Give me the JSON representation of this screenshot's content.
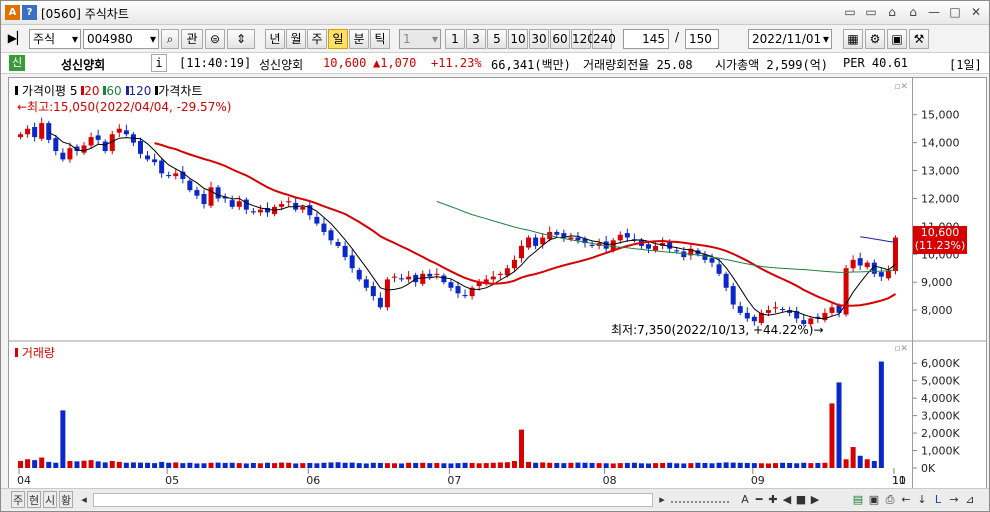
{
  "titlebar": {
    "icon_a": "A",
    "icon_help": "?",
    "title": "[0560] 주식차트",
    "controls": [
      "▭",
      "▭",
      "⌂",
      "⌂",
      "—",
      "□",
      "✕"
    ]
  },
  "toolbar": {
    "market_select": "주식",
    "code_input": "004980",
    "btn_view": "관",
    "period_buttons": [
      "년",
      "월",
      "주",
      "일",
      "분",
      "틱"
    ],
    "active_period": "일",
    "interval_select": "1",
    "interval_buttons": [
      "1",
      "3",
      "5",
      "10",
      "30",
      "60",
      "120",
      "240"
    ],
    "count_value": "145",
    "slash": "/",
    "count_total": "150",
    "date_value": "2022/11/01"
  },
  "infobar": {
    "badge": "신",
    "stock_name": "성신양회",
    "info_btn": "i",
    "time": "[11:40:19]",
    "name2": "성신양회",
    "price": "10,600",
    "change": "▲1,070",
    "change_pct": "+11.23%",
    "volume": "66,341(백만)",
    "turnover": "거래량회전율 25.08",
    "market_cap": "시가총액 2,599(억)",
    "per": "PER 40.61",
    "period_tag": "[1일]"
  },
  "legend": {
    "price_title": "가격이평",
    "ma_items": [
      "5",
      "20",
      "60",
      "120"
    ],
    "price_chart": "가격차트",
    "volume": "거래량"
  },
  "annotations": {
    "high": "←최고:15,050(2022/04/04, -29.57%)",
    "low": "최저:7,350(2022/10/13, +44.22%)→",
    "current_price": "10,600",
    "current_pct": "(11.23%)"
  },
  "colors": {
    "up": "#d60000",
    "down": "#0a28c8",
    "ma5": "#000000",
    "ma20": "#d60000",
    "ma60": "#208040",
    "ma120": "#2020a0"
  },
  "bottom": {
    "buttons": [
      "주",
      "현",
      "시",
      "황"
    ]
  },
  "chart_data": {
    "type": "candlestick",
    "price_axis_ticks": [
      "15,000",
      "14,000",
      "13,000",
      "12,000",
      "11,000",
      "10,000",
      "9,000",
      "8,000"
    ],
    "volume_axis_ticks": [
      "6,000K",
      "5,000K",
      "4,000K",
      "3,000K",
      "2,000K",
      "1,000K",
      "0K"
    ],
    "x_ticks": [
      "04",
      "05",
      "06",
      "07",
      "08",
      "09",
      "10",
      "11"
    ],
    "high": 15050,
    "low": 7350,
    "last_close": 10600,
    "closes": [
      14300,
      14500,
      14200,
      14700,
      14100,
      13700,
      13400,
      13800,
      13700,
      13900,
      14200,
      14100,
      13700,
      14300,
      14500,
      14300,
      14000,
      13600,
      13400,
      13300,
      12900,
      12800,
      12900,
      12700,
      12300,
      12100,
      11800,
      12400,
      12000,
      12000,
      11700,
      11900,
      11600,
      11500,
      11600,
      11500,
      11700,
      11800,
      11900,
      11600,
      11700,
      11400,
      11100,
      10800,
      10500,
      10300,
      9900,
      9500,
      9100,
      8800,
      8500,
      8100,
      9100,
      9200,
      9100,
      9200,
      9000,
      9300,
      9200,
      9300,
      9000,
      8800,
      8600,
      8500,
      8800,
      9000,
      9100,
      9200,
      9300,
      9500,
      9800,
      10300,
      10600,
      10300,
      10600,
      10800,
      10700,
      10600,
      10600,
      10500,
      10400,
      10300,
      10400,
      10200,
      10500,
      10700,
      10600,
      10500,
      10300,
      10200,
      10300,
      10400,
      10200,
      10100,
      9900,
      10200,
      10000,
      9800,
      9700,
      9300,
      8800,
      8200,
      7900,
      7700,
      7600,
      7900,
      8000,
      8100,
      8000,
      7900,
      7700,
      7500,
      7700,
      7700,
      7900,
      8100,
      7900,
      9500,
      9800,
      9600,
      9700,
      9300,
      9200,
      9400,
      10600
    ],
    "volumes": [
      400,
      500,
      450,
      600,
      350,
      300,
      3300,
      400,
      380,
      420,
      450,
      380,
      320,
      400,
      350,
      300,
      320,
      310,
      300,
      280,
      350,
      300,
      320,
      280,
      300,
      260,
      270,
      300,
      310,
      290,
      300,
      280,
      260,
      290,
      270,
      300,
      280,
      310,
      300,
      260,
      280,
      290,
      270,
      300,
      320,
      330,
      300,
      310,
      280,
      260,
      300,
      290,
      280,
      270,
      260,
      300,
      290,
      300,
      280,
      290,
      270,
      260,
      280,
      300,
      290,
      270,
      280,
      300,
      320,
      330,
      400,
      2200,
      350,
      300,
      320,
      300,
      290,
      280,
      300,
      310,
      300,
      290,
      280,
      270,
      260,
      280,
      290,
      300,
      270,
      260,
      280,
      290,
      300,
      270,
      260,
      280,
      300,
      290,
      270,
      300,
      320,
      310,
      300,
      290,
      280,
      270,
      260,
      280,
      300,
      290,
      270,
      300,
      280,
      290,
      300,
      3700,
      4900,
      500,
      1200,
      700,
      500,
      400,
      6100
    ]
  }
}
